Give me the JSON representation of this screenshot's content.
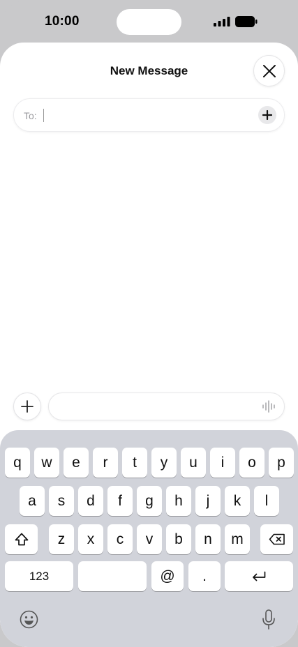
{
  "status": {
    "time": "10:00"
  },
  "sheet": {
    "title": "New Message"
  },
  "to_field": {
    "label": "To:",
    "value": ""
  },
  "compose": {
    "message_value": ""
  },
  "keyboard": {
    "row1": [
      "q",
      "w",
      "e",
      "r",
      "t",
      "y",
      "u",
      "i",
      "o",
      "p"
    ],
    "row2": [
      "a",
      "s",
      "d",
      "f",
      "g",
      "h",
      "j",
      "k",
      "l"
    ],
    "row3": [
      "z",
      "x",
      "c",
      "v",
      "b",
      "n",
      "m"
    ],
    "numbers_label": "123",
    "at_label": "@",
    "dot_label": "."
  },
  "icons": {
    "close": "close-icon",
    "add": "plus-icon",
    "waveform": "waveform-icon",
    "shift": "shift-icon",
    "delete": "delete-icon",
    "return": "return-icon",
    "emoji": "emoji-icon",
    "mic": "microphone-icon"
  }
}
